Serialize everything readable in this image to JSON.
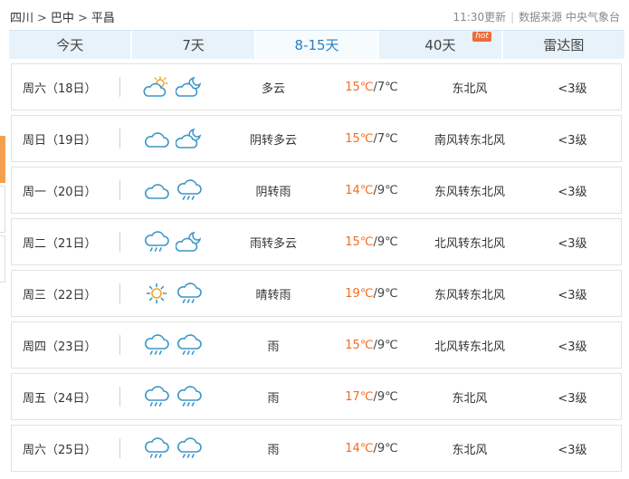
{
  "breadcrumb": {
    "items": [
      "四川",
      "巴中",
      "平昌"
    ],
    "separator": ">"
  },
  "meta": {
    "updated": "11:30更新",
    "source": "数据来源 中央气象台"
  },
  "tabs": [
    {
      "label": "今天",
      "active": false
    },
    {
      "label": "7天",
      "active": false
    },
    {
      "label": "8-15天",
      "active": true
    },
    {
      "label": "40天",
      "active": false,
      "badge": "hot"
    },
    {
      "label": "雷达图",
      "active": false
    }
  ],
  "colors": {
    "accent": "#2a7fc0",
    "high_temp": "#f36c21",
    "tab_bg": "#e7f2fa",
    "hot_badge": "#ef6a3a",
    "icon_stroke": "#3c96c8",
    "sun": "#f5a623"
  },
  "forecast": [
    {
      "day": "周六（18日）",
      "icons": [
        "partly-cloudy-icon",
        "partly-cloudy-night-icon"
      ],
      "desc": "多云",
      "high": "15℃",
      "low": "/7℃",
      "wind": "东北风",
      "level": "<3级"
    },
    {
      "day": "周日（19日）",
      "icons": [
        "cloud-icon",
        "partly-cloudy-night-icon"
      ],
      "desc": "阴转多云",
      "high": "15℃",
      "low": "/7℃",
      "wind": "南风转东北风",
      "level": "<3级"
    },
    {
      "day": "周一（20日）",
      "icons": [
        "cloud-icon",
        "rain-icon"
      ],
      "desc": "阴转雨",
      "high": "14℃",
      "low": "/9℃",
      "wind": "东风转东北风",
      "level": "<3级"
    },
    {
      "day": "周二（21日）",
      "icons": [
        "rain-icon",
        "partly-cloudy-night-icon"
      ],
      "desc": "雨转多云",
      "high": "15℃",
      "low": "/9℃",
      "wind": "北风转东北风",
      "level": "<3级"
    },
    {
      "day": "周三（22日）",
      "icons": [
        "sun-icon",
        "rain-icon"
      ],
      "desc": "晴转雨",
      "high": "19℃",
      "low": "/9℃",
      "wind": "东风转东北风",
      "level": "<3级"
    },
    {
      "day": "周四（23日）",
      "icons": [
        "rain-icon",
        "rain-icon"
      ],
      "desc": "雨",
      "high": "15℃",
      "low": "/9℃",
      "wind": "北风转东北风",
      "level": "<3级"
    },
    {
      "day": "周五（24日）",
      "icons": [
        "rain-icon",
        "rain-icon"
      ],
      "desc": "雨",
      "high": "17℃",
      "low": "/9℃",
      "wind": "东北风",
      "level": "<3级"
    },
    {
      "day": "周六（25日）",
      "icons": [
        "rain-icon",
        "rain-icon"
      ],
      "desc": "雨",
      "high": "14℃",
      "low": "/9℃",
      "wind": "东北风",
      "level": "<3级"
    }
  ]
}
